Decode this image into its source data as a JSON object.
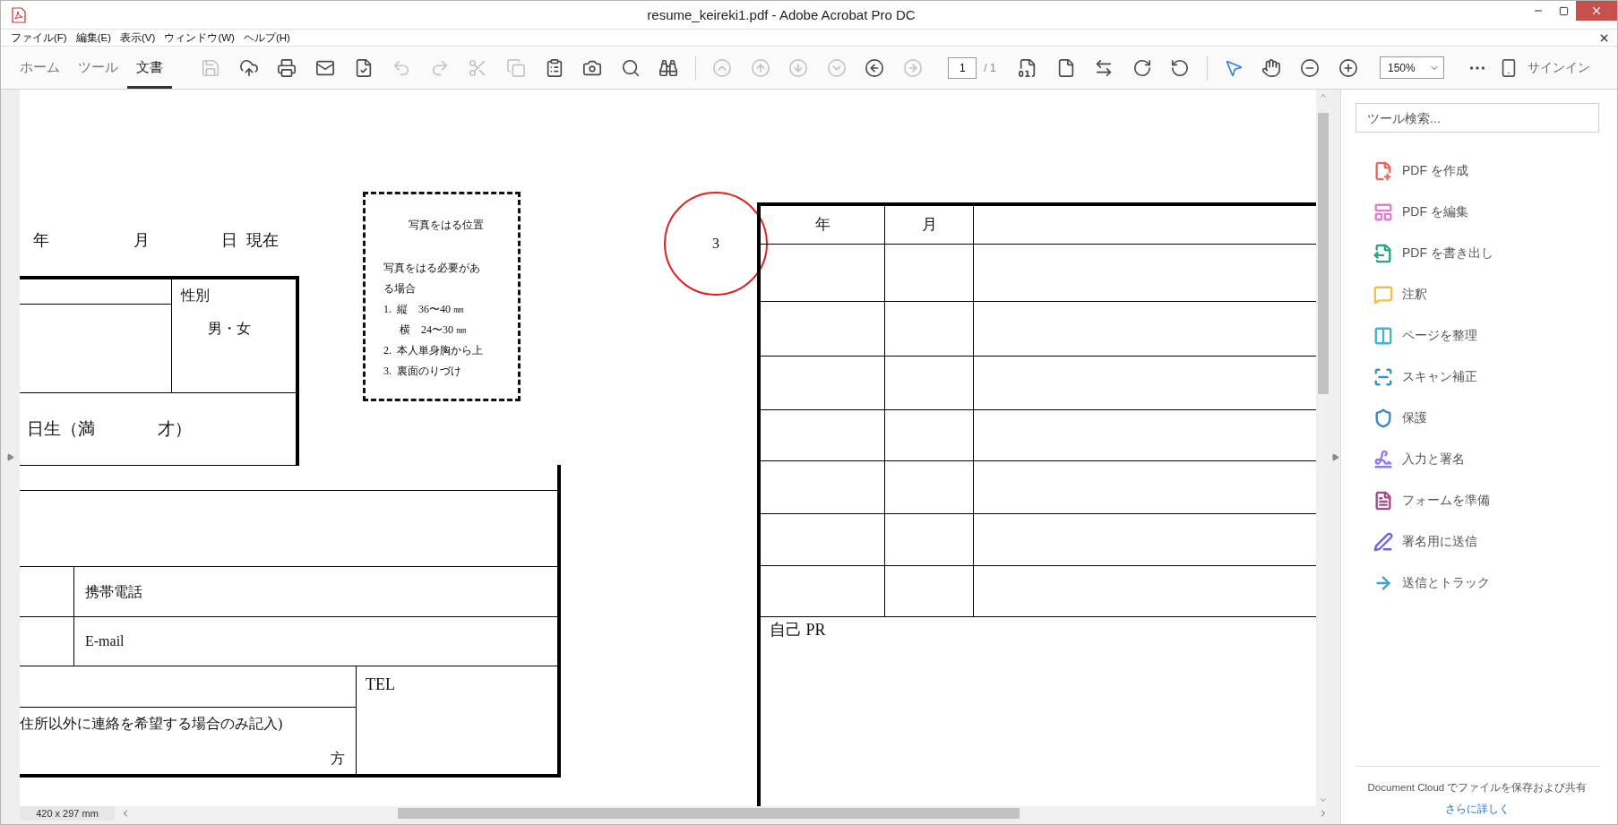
{
  "window": {
    "title": "resume_keireki1.pdf - Adobe Acrobat Pro DC"
  },
  "menu": [
    "ファイル(F)",
    "編集(E)",
    "表示(V)",
    "ウィンドウ(W)",
    "ヘルプ(H)"
  ],
  "tabs": [
    {
      "label": "ホーム",
      "selected": false
    },
    {
      "label": "ツール",
      "selected": false
    },
    {
      "label": "文書",
      "selected": true
    }
  ],
  "toolbar": {
    "file_tools": [
      {
        "kind": "save",
        "disabled": true
      },
      {
        "kind": "upload",
        "disabled": false
      },
      {
        "kind": "print",
        "disabled": false
      },
      {
        "kind": "mail",
        "disabled": false
      },
      {
        "kind": "certify",
        "disabled": false
      },
      {
        "kind": "undo",
        "disabled": true
      },
      {
        "kind": "redo",
        "disabled": true
      },
      {
        "kind": "cut",
        "disabled": true
      },
      {
        "kind": "copy",
        "disabled": true
      },
      {
        "kind": "paste",
        "disabled": false
      },
      {
        "kind": "snapshot",
        "disabled": false
      },
      {
        "kind": "find",
        "disabled": false
      },
      {
        "kind": "compare",
        "disabled": false
      }
    ],
    "nav_tools": [
      {
        "kind": "first",
        "disabled": true
      },
      {
        "kind": "up",
        "disabled": true
      },
      {
        "kind": "down",
        "disabled": true
      },
      {
        "kind": "last",
        "disabled": true
      },
      {
        "kind": "back",
        "disabled": false
      },
      {
        "kind": "forward",
        "disabled": true
      }
    ],
    "page": {
      "value": "1",
      "total": "/ 1"
    },
    "view_tools": [
      {
        "kind": "actual-size"
      },
      {
        "kind": "fit-page"
      },
      {
        "kind": "fit-width"
      },
      {
        "kind": "rotate-cw"
      },
      {
        "kind": "rotate-ccw"
      }
    ],
    "pointer_tools": [
      {
        "kind": "select",
        "selected": true
      },
      {
        "kind": "hand",
        "selected": false
      }
    ],
    "zoom_tools": [
      {
        "kind": "zoom-out"
      },
      {
        "kind": "zoom-in"
      }
    ],
    "zoom": "150%",
    "sign_in": "サインイン"
  },
  "document": {
    "date_labels": [
      "年",
      "月",
      "日",
      "現在"
    ],
    "gender_label": "性別",
    "gender_options": "男・女",
    "birth": "日生（満",
    "age": "才）",
    "mobile": "携帯電話",
    "email": "E-mail",
    "contact_note": "住所以外に連絡を希望する場合のみ記入)",
    "contact_suffix": "方",
    "tel": "TEL",
    "photo_box": {
      "title": "写真をはる位置",
      "lines": [
        "写真をはる必要があ",
        "る場合",
        "1.  縦　36〜40 ㎜",
        "　  横　24〜30 ㎜",
        "2.  本人単身胸から上",
        "3.  裏面のりづけ"
      ]
    },
    "annotation": "3",
    "history": {
      "columns": [
        "年",
        "月"
      ],
      "pr_label": "自己 PR"
    }
  },
  "status_bar": {
    "page_size": "420 x 297 mm"
  },
  "tools_panel": {
    "search": {
      "placeholder": "ツール検索..."
    },
    "tools": [
      {
        "kind": "create",
        "label": "PDF を作成",
        "color": "#e8675f"
      },
      {
        "kind": "edit",
        "label": "PDF を編集",
        "color": "#e57cd2"
      },
      {
        "kind": "export",
        "label": "PDF を書き出し",
        "color": "#2aa57c"
      },
      {
        "kind": "comment",
        "label": "注釈",
        "color": "#f0bf4c"
      },
      {
        "kind": "organize",
        "label": "ページを整理",
        "color": "#3fb6d8"
      },
      {
        "kind": "scan",
        "label": "スキャン補正",
        "color": "#3f8fc0"
      },
      {
        "kind": "protect",
        "label": "保護",
        "color": "#3d86c9"
      },
      {
        "kind": "sign",
        "label": "入力と署名",
        "color": "#8f7bef"
      },
      {
        "kind": "form",
        "label": "フォームを準備",
        "color": "#a3498f"
      },
      {
        "kind": "send-sign",
        "label": "署名用に送信",
        "color": "#6b66e8"
      },
      {
        "kind": "track",
        "label": "送信とトラック",
        "color": "#3ba0cf"
      }
    ],
    "footer": "Document Cloud でファイルを保存および共有",
    "link": "さらに詳しく"
  }
}
